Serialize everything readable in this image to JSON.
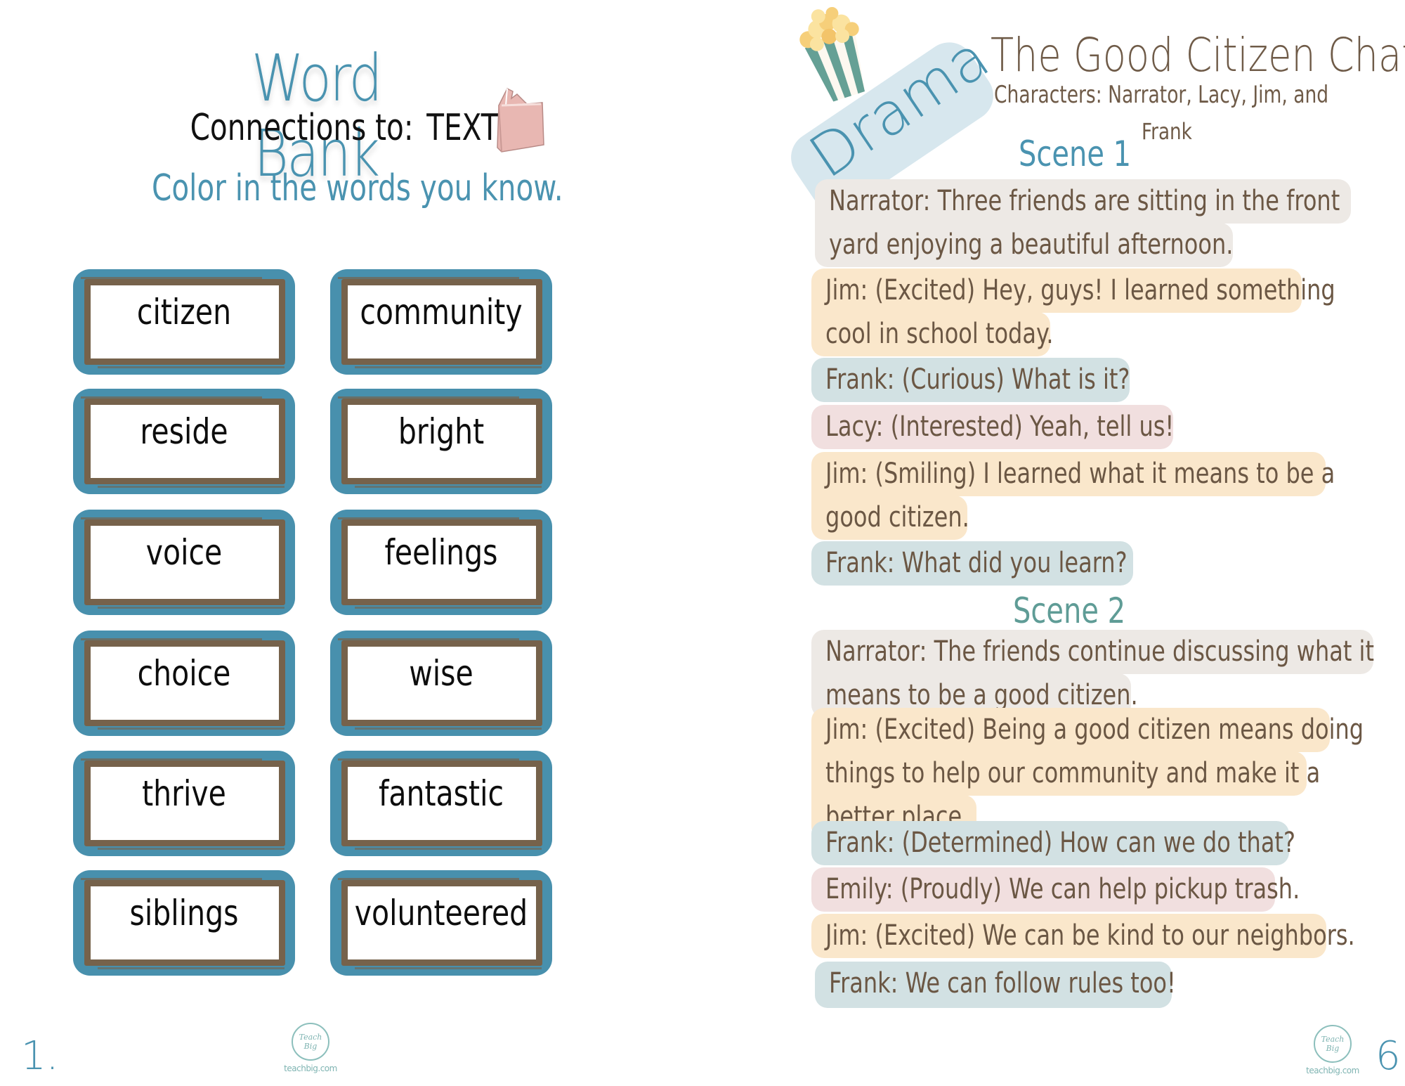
{
  "left_page": {
    "title": "Word Bank",
    "subtitle_prefix": "Connections to:",
    "subtitle_topic": "TEXT",
    "instruction": "Color in the words you know.",
    "icon": "book-icon",
    "words": [
      "citizen",
      "community",
      "reside",
      "bright",
      "voice",
      "feelings",
      "choice",
      "wise",
      "thrive",
      "fantastic",
      "siblings",
      "volunteered"
    ],
    "page_number": "1.",
    "logo_text": "Teach Big",
    "logo_site": "teachbig.com"
  },
  "right_page": {
    "badge": "Drama",
    "badge_icon": "popcorn-icon",
    "title": "The Good Citizen Chat",
    "characters_line1": "Characters: Narrator, Lacy, Jim, and",
    "characters_line2": "Frank",
    "scenes": [
      {
        "heading": "Scene 1",
        "lines": [
          {
            "speaker": "Narrator",
            "lines": [
              "Narrator:  Three friends are sitting in the front",
              "yard enjoying a beautiful afternoon."
            ]
          },
          {
            "speaker": "Jim",
            "lines": [
              "Jim: (Excited) Hey, guys! I learned something",
              "cool in school today."
            ]
          },
          {
            "speaker": "Frank",
            "lines": [
              "Frank: (Curious) What is it?"
            ]
          },
          {
            "speaker": "Lacy",
            "lines": [
              "Lacy: (Interested) Yeah, tell us!"
            ]
          },
          {
            "speaker": "Jim",
            "lines": [
              "Jim: (Smiling) I learned what it means to be a",
              "good citizen."
            ]
          },
          {
            "speaker": "Frank",
            "lines": [
              "Frank: What did you learn?"
            ]
          }
        ]
      },
      {
        "heading": "Scene 2",
        "lines": [
          {
            "speaker": "Narrator",
            "lines": [
              "Narrator:  The friends continue discussing what it",
              "means to be a good citizen."
            ]
          },
          {
            "speaker": "Jim",
            "lines": [
              "Jim: (Excited) Being a good citizen means doing",
              "things to help our community and make it a",
              "better place."
            ]
          },
          {
            "speaker": "Frank",
            "lines": [
              "Frank: (Determined) How can we do that?"
            ]
          },
          {
            "speaker": "Emily",
            "lines": [
              "Emily: (Proudly) We can help pickup trash."
            ]
          },
          {
            "speaker": "Jim",
            "lines": [
              "Jim: (Excited) We can be kind to our neighbors."
            ]
          },
          {
            "speaker": "Frank",
            "lines": [
              "Frank: We can follow rules too!"
            ]
          }
        ]
      }
    ],
    "page_number": "6.",
    "logo_text": "Teach Big",
    "logo_site": "teachbig.com"
  },
  "colors": {
    "accent_blue": "#4a93b0",
    "card_blue": "#4890ad",
    "card_brown": "#76624b",
    "text_brown": "#6b5744",
    "narrator_bg": "#ede9e5",
    "jim_bg": "#fae7cb",
    "frank_bg": "#d2e1e3",
    "lacy_emily_bg": "#f1dfdf",
    "drama_badge_bg": "#d7e7ee"
  }
}
